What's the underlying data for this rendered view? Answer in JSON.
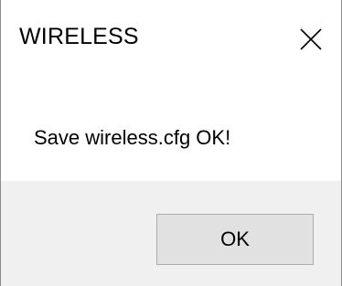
{
  "window": {
    "title": "WIRELESS",
    "close_icon": "close-icon"
  },
  "dialog": {
    "message": "Save wireless.cfg OK!"
  },
  "buttons": {
    "ok_label": "OK"
  },
  "colors": {
    "footer_background": "#f0f0f0",
    "button_background": "#e1e1e1",
    "button_border": "#adadad"
  }
}
